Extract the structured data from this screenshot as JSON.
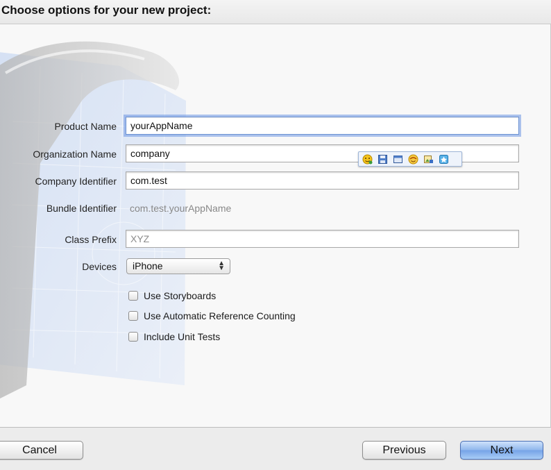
{
  "header": {
    "title": "Choose options for your new project:"
  },
  "form": {
    "product_name": {
      "label": "Product Name",
      "value": "yourAppName"
    },
    "organization_name": {
      "label": "Organization Name",
      "value": "company"
    },
    "company_identifier": {
      "label": "Company Identifier",
      "value": "com.test"
    },
    "bundle_identifier": {
      "label": "Bundle Identifier",
      "value": "com.test.yourAppName"
    },
    "class_prefix": {
      "label": "Class Prefix",
      "placeholder": "XYZ"
    },
    "devices": {
      "label": "Devices",
      "selected": "iPhone"
    },
    "checkboxes": [
      {
        "label": "Use Storyboards",
        "checked": false
      },
      {
        "label": "Use Automatic Reference Counting",
        "checked": false
      },
      {
        "label": "Include Unit Tests",
        "checked": false
      }
    ]
  },
  "popover_toolbar": {
    "icons": [
      "smiley-plus-icon",
      "save-icon",
      "window-icon",
      "emoji-icon",
      "image-edit-icon",
      "bookmark-icon"
    ]
  },
  "buttons": {
    "cancel": "Cancel",
    "previous": "Previous",
    "next": "Next"
  },
  "colors": {
    "focus_ring": "#6d93d3",
    "default_button": "#8fb6ec"
  }
}
